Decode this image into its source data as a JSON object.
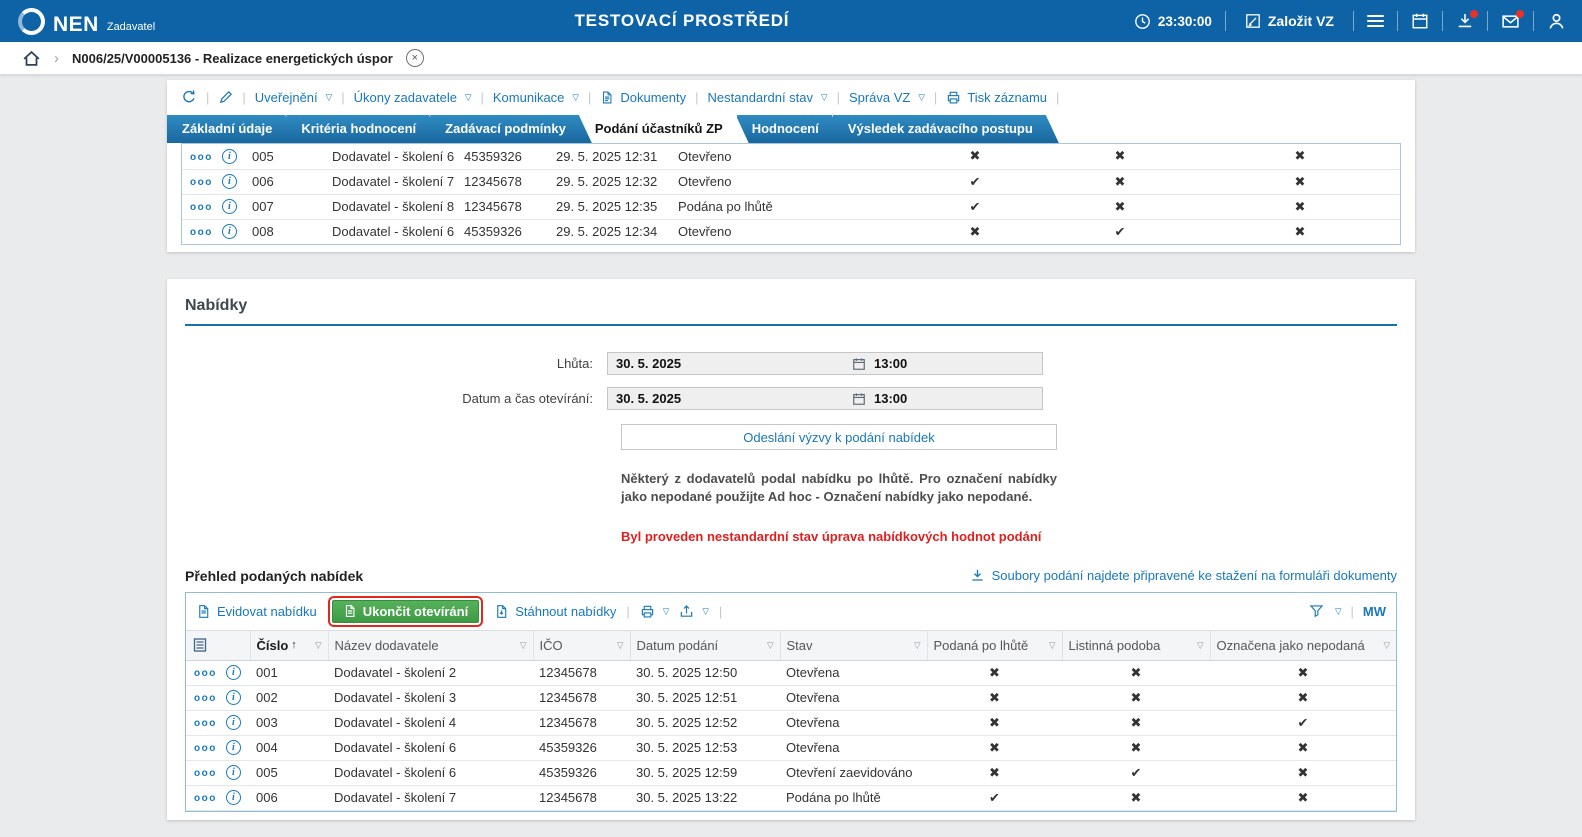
{
  "colors": {
    "topbar-bg": "#0d63a5",
    "accent": "#1878ba",
    "green": "#3da345",
    "red": "#e23b35",
    "green-button": "#4aa94f",
    "warning-red": "#e01f1f"
  },
  "icons": {
    "row_menu": "ooo",
    "info": "i",
    "check": "✔",
    "cross": "✖",
    "caret": "▽",
    "sort_asc": "↑",
    "chevron": "›",
    "close": "×"
  },
  "topbar": {
    "logo_text": "NEN",
    "logo_subtext": "Zadavatel",
    "title": "TESTOVACÍ PROSTŘEDÍ",
    "clock": "23:30:00",
    "create_button": "Založit VZ"
  },
  "breadcrumb": {
    "item": "N006/25/V00005136 - Realizace energetických úspor"
  },
  "toolbar": {
    "items": [
      {
        "label": "Uveřejnění",
        "caret": true
      },
      {
        "label": "Úkony zadavatele",
        "caret": true
      },
      {
        "label": "Komunikace",
        "caret": true
      },
      {
        "label": "Dokumenty",
        "icon": "document-icon"
      },
      {
        "label": "Nestandardní stav",
        "caret": true
      },
      {
        "label": "Správa VZ",
        "caret": true
      },
      {
        "label": "Tisk záznamu",
        "icon": "printer-icon"
      }
    ]
  },
  "tabs": [
    {
      "label": "Základní údaje",
      "active": false
    },
    {
      "label": "Kritéria hodnocení",
      "active": false
    },
    {
      "label": "Zadávací podmínky",
      "active": false
    },
    {
      "label": "Podání účastníků ZP",
      "active": true
    },
    {
      "label": "Hodnocení",
      "active": false
    },
    {
      "label": "Výsledek zadávacího postupu",
      "active": false
    }
  ],
  "upper_table": {
    "rows": [
      {
        "cells": [
          "005",
          "Dodavatel - školení 6",
          "45359326",
          "29. 5. 2025 12:31",
          "Otevřeno"
        ],
        "flags": [
          "cross",
          "cross",
          "cross"
        ]
      },
      {
        "cells": [
          "006",
          "Dodavatel - školení 7",
          "12345678",
          "29. 5. 2025 12:32",
          "Otevřeno"
        ],
        "flags": [
          "check",
          "cross",
          "cross"
        ]
      },
      {
        "cells": [
          "007",
          "Dodavatel - školení 8",
          "12345678",
          "29. 5. 2025 12:35",
          "Podána po lhůtě"
        ],
        "flags": [
          "check",
          "cross",
          "cross"
        ]
      },
      {
        "cells": [
          "008",
          "Dodavatel - školení 6",
          "45359326",
          "29. 5. 2025 12:34",
          "Otevřeno"
        ],
        "flags": [
          "cross",
          "check",
          "cross"
        ]
      }
    ]
  },
  "nabidky": {
    "title": "Nabídky",
    "lhuta_label": "Lhůta:",
    "lhuta_date": "30. 5. 2025",
    "lhuta_time": "13:00",
    "otevirani_label": "Datum a čas otevírání:",
    "otevirani_date": "30. 5. 2025",
    "otevirani_time": "13:00",
    "send_button": "Odeslání výzvy k podání nabídek",
    "note": "Některý z dodavatelů podal nabídku po lhůtě. Pro označení nabídky jako nepodané použijte Ad hoc - Označení nabídky jako nepodané.",
    "warning": "Byl proveden nestandardní stav úprava nabídkových hodnot podání"
  },
  "prehled": {
    "title": "Přehled podaných nabídek",
    "download_link": "Soubory podání najdete připravené ke stažení na formuláři dokumenty",
    "toolbar": {
      "evidovat": "Evidovat nabídku",
      "ukoncit": "Ukončit otevírání",
      "stahnout": "Stáhnout nabídky",
      "user": "MW"
    },
    "headers": [
      {
        "label": "Číslo",
        "sorted": true
      },
      {
        "label": "Název dodavatele"
      },
      {
        "label": "IČO"
      },
      {
        "label": "Datum podání"
      },
      {
        "label": "Stav"
      },
      {
        "label": "Podaná po lhůtě"
      },
      {
        "label": "Listinná podoba"
      },
      {
        "label": "Označena jako nepodaná"
      }
    ],
    "rows": [
      {
        "cells": [
          "001",
          "Dodavatel - školení 2",
          "12345678",
          "30. 5. 2025 12:50",
          "Otevřena"
        ],
        "flags": [
          "cross",
          "cross",
          "cross"
        ]
      },
      {
        "cells": [
          "002",
          "Dodavatel - školení 3",
          "12345678",
          "30. 5. 2025 12:51",
          "Otevřena"
        ],
        "flags": [
          "cross",
          "cross",
          "cross"
        ]
      },
      {
        "cells": [
          "003",
          "Dodavatel - školení 4",
          "12345678",
          "30. 5. 2025 12:52",
          "Otevřena"
        ],
        "flags": [
          "cross",
          "cross",
          "check"
        ]
      },
      {
        "cells": [
          "004",
          "Dodavatel - školení 6",
          "45359326",
          "30. 5. 2025 12:53",
          "Otevřena"
        ],
        "flags": [
          "cross",
          "cross",
          "cross"
        ]
      },
      {
        "cells": [
          "005",
          "Dodavatel - školení 6",
          "45359326",
          "30. 5. 2025 12:59",
          "Otevření zaevidováno"
        ],
        "flags": [
          "cross",
          "check",
          "cross"
        ]
      },
      {
        "cells": [
          "006",
          "Dodavatel - školení 7",
          "12345678",
          "30. 5. 2025 13:22",
          "Podána po lhůtě"
        ],
        "flags": [
          "check",
          "cross",
          "cross"
        ]
      }
    ]
  }
}
